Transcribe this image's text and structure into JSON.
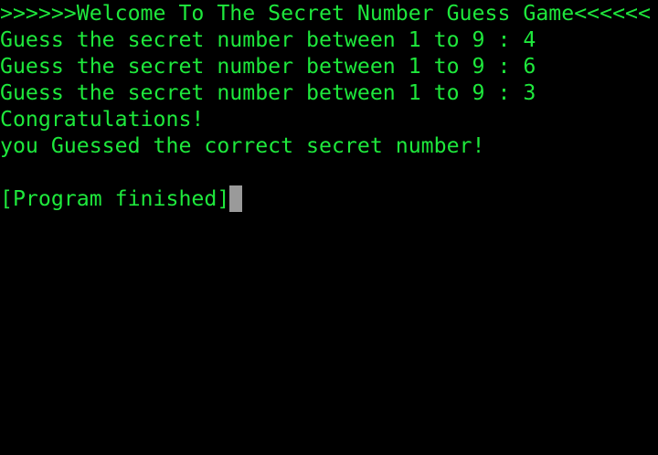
{
  "terminal": {
    "text_color": "#1ee83c",
    "background_color": "#000000",
    "cursor_color": "#9a9a9a",
    "lines": [
      ">>>>>>Welcome To The Secret Number Guess Game<<<<<<",
      "Guess the secret number between 1 to 9 : 4",
      "Guess the secret number between 1 to 9 : 6",
      "Guess the secret number between 1 to 9 : 3",
      "Congratulations!",
      "you Guessed the correct secret number!"
    ],
    "final_status": "[Program finished]"
  }
}
